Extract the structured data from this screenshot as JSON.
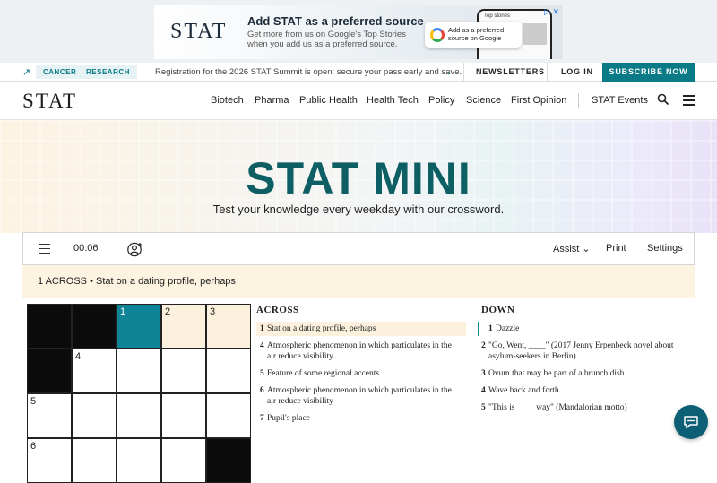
{
  "ad": {
    "logo": "STAT",
    "title": "Add STAT as a preferred source",
    "subtitle": "Get more from us on Google's Top Stories when you add us as a preferred source.",
    "card_text": "Add as a preferred source on Google",
    "phone_label": "Top stories",
    "close_label": "▷ ✕"
  },
  "topbar": {
    "tags": [
      "CANCER",
      "RESEARCH"
    ],
    "announcement": "Registration for the 2026 STAT Summit is open: secure your pass early and save.",
    "newsletters": "NEWSLETTERS",
    "login": "LOG IN",
    "subscribe": "SUBSCRIBE NOW"
  },
  "nav": {
    "logo": "STAT",
    "items": [
      "Biotech",
      "Pharma",
      "Public Health",
      "Health Tech",
      "Policy",
      "Science",
      "First Opinion"
    ],
    "events": "STAT Events"
  },
  "hero": {
    "title": "STAT MINI",
    "subtitle": "Test your knowledge every weekday with our crossword."
  },
  "toolbar": {
    "timer": "00:06",
    "assist": "Assist ⌄",
    "print": "Print",
    "settings": "Settings"
  },
  "current_clue": "1 ACROSS • Stat on a dating profile, perhaps",
  "grid": {
    "numbers": [
      "1",
      "2",
      "3",
      "4",
      "5",
      "6"
    ]
  },
  "across": {
    "heading": "ACROSS",
    "clues": [
      {
        "n": "1",
        "text": "Stat on a dating profile, perhaps"
      },
      {
        "n": "4",
        "text": "Atmospheric phenomenon in which particulates in the air reduce visibility"
      },
      {
        "n": "5",
        "text": "Feature of some regional accents"
      },
      {
        "n": "6",
        "text": "Atmospheric phenomenon in which particulates in the air reduce visibility"
      },
      {
        "n": "7",
        "text": "Pupil's place"
      }
    ]
  },
  "down": {
    "heading": "DOWN",
    "clues": [
      {
        "n": "1",
        "text": "Dazzle"
      },
      {
        "n": "2",
        "text": "\"Go, Went, ____\" (2017 Jenny Erpenbeck novel about asylum-seekers in Berlin)"
      },
      {
        "n": "3",
        "text": "Ovum that may be part of a brunch dish"
      },
      {
        "n": "4",
        "text": "Wave back and forth"
      },
      {
        "n": "5",
        "text": "\"This is ____ way\" (Mandalorian motto)"
      }
    ]
  }
}
